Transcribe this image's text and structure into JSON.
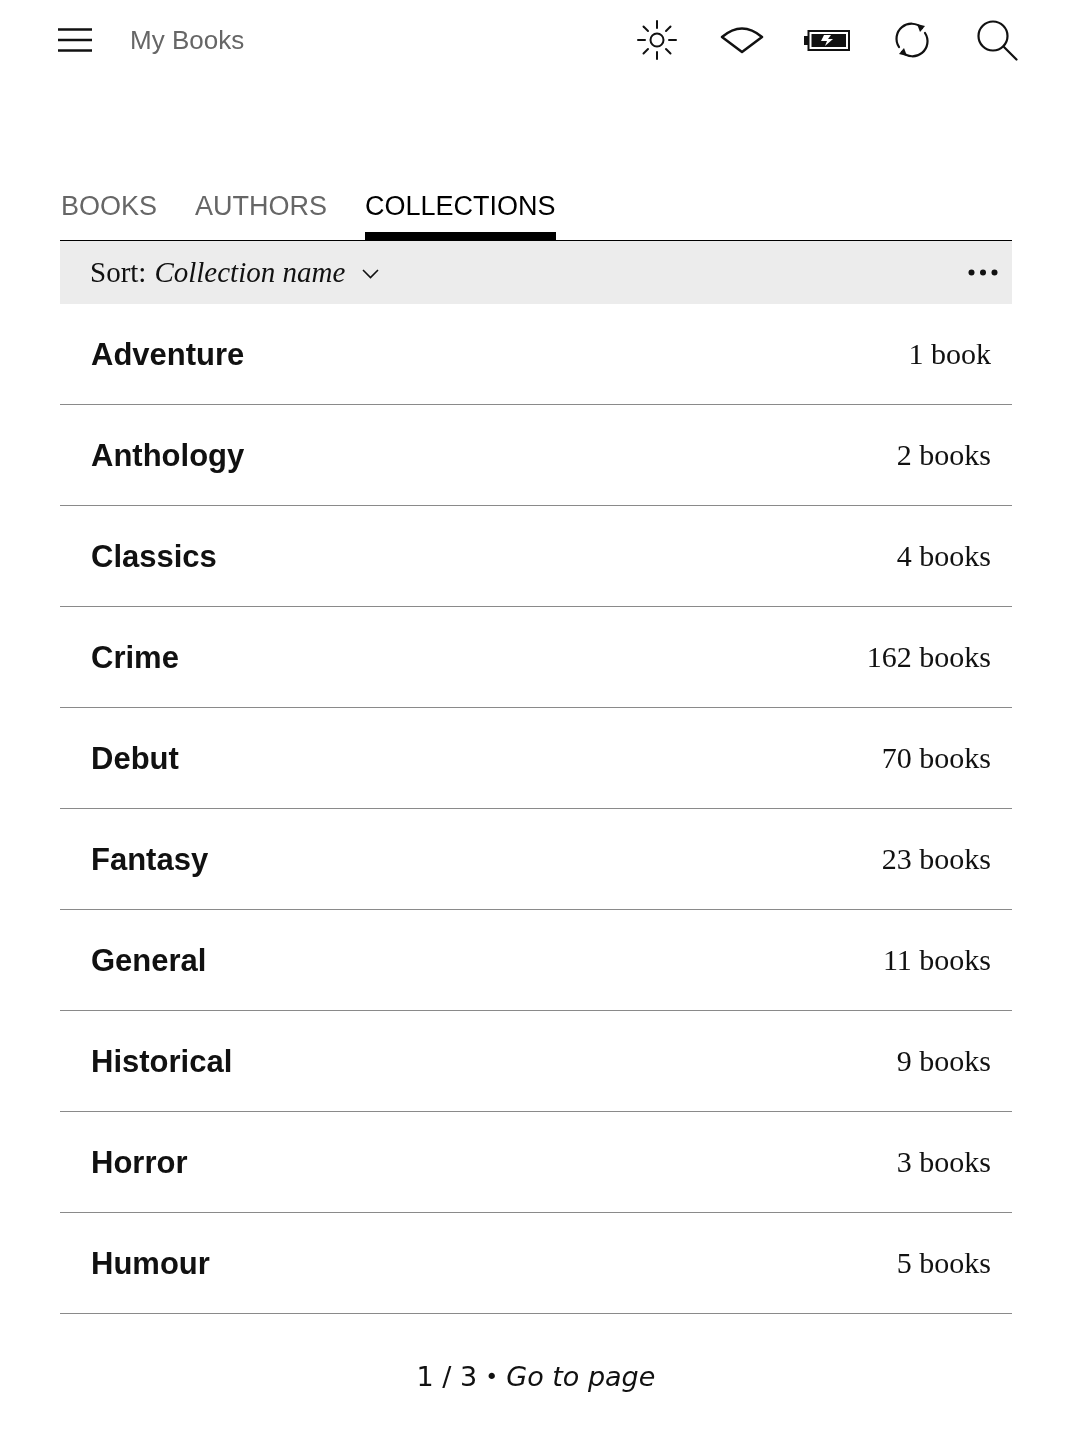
{
  "header": {
    "title": "My Books"
  },
  "tabs": [
    {
      "label": "BOOKS",
      "selected": false
    },
    {
      "label": "AUTHORS",
      "selected": false
    },
    {
      "label": "COLLECTIONS",
      "selected": true
    }
  ],
  "sort": {
    "label": "Sort:",
    "value": "Collection name"
  },
  "collections": [
    {
      "name": "Adventure",
      "count": "1 book"
    },
    {
      "name": "Anthology",
      "count": "2 books"
    },
    {
      "name": "Classics",
      "count": "4 books"
    },
    {
      "name": "Crime",
      "count": "162 books"
    },
    {
      "name": "Debut",
      "count": "70 books"
    },
    {
      "name": "Fantasy",
      "count": "23 books"
    },
    {
      "name": "General",
      "count": "11 books"
    },
    {
      "name": "Historical",
      "count": "9 books"
    },
    {
      "name": "Horror",
      "count": "3 books"
    },
    {
      "name": "Humour",
      "count": "5 books"
    }
  ],
  "pagination": {
    "page": "1 / 3",
    "separator": "•",
    "link": "Go to page"
  }
}
